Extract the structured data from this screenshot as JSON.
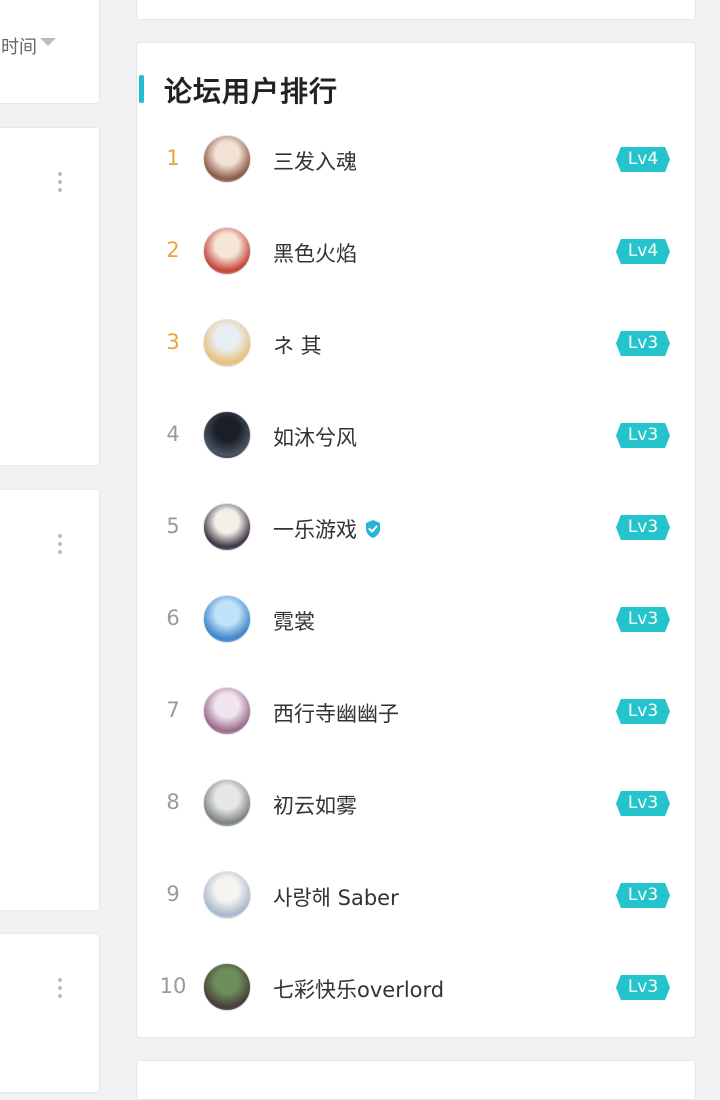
{
  "left": {
    "sort_label": "时间"
  },
  "ranking": {
    "title": "论坛用户排行",
    "items": [
      {
        "rank": "1",
        "name": "三发入魂",
        "level": "Lv4",
        "verified": false,
        "avatar_colors": [
          "#f3e1d6",
          "#8b5a45"
        ]
      },
      {
        "rank": "2",
        "name": "黑色火焰",
        "level": "Lv4",
        "verified": false,
        "avatar_colors": [
          "#f5e6d6",
          "#c5433a"
        ]
      },
      {
        "rank": "3",
        "name": "ネ 其",
        "level": "Lv3",
        "verified": false,
        "avatar_colors": [
          "#e8eef3",
          "#e7c17b"
        ]
      },
      {
        "rank": "4",
        "name": "如沐兮风",
        "level": "Lv3",
        "verified": false,
        "avatar_colors": [
          "#1a1f28",
          "#4b5566"
        ]
      },
      {
        "rank": "5",
        "name": "一乐游戏",
        "level": "Lv3",
        "verified": true,
        "avatar_colors": [
          "#f4efe8",
          "#3b3343"
        ]
      },
      {
        "rank": "6",
        "name": "霓裳",
        "level": "Lv3",
        "verified": false,
        "avatar_colors": [
          "#bfe3f8",
          "#3d84c9"
        ]
      },
      {
        "rank": "7",
        "name": "西行寺幽幽子",
        "level": "Lv3",
        "verified": false,
        "avatar_colors": [
          "#f0e4ef",
          "#9b6a8a"
        ]
      },
      {
        "rank": "8",
        "name": "初云如雾",
        "level": "Lv3",
        "verified": false,
        "avatar_colors": [
          "#e6e8e6",
          "#7d837e"
        ]
      },
      {
        "rank": "9",
        "name": "사랑해 Saber",
        "level": "Lv3",
        "verified": false,
        "avatar_colors": [
          "#f5f4f1",
          "#a8b8cc"
        ]
      },
      {
        "rank": "10",
        "name": "七彩快乐overlord",
        "level": "Lv3",
        "verified": false,
        "avatar_colors": [
          "#6c8f5a",
          "#4a3c3a"
        ]
      }
    ]
  },
  "colors": {
    "accent": "#1fbfd0",
    "top_rank": "#f0a234",
    "badge": "#25c4cc",
    "verified": "#25b6d6"
  }
}
